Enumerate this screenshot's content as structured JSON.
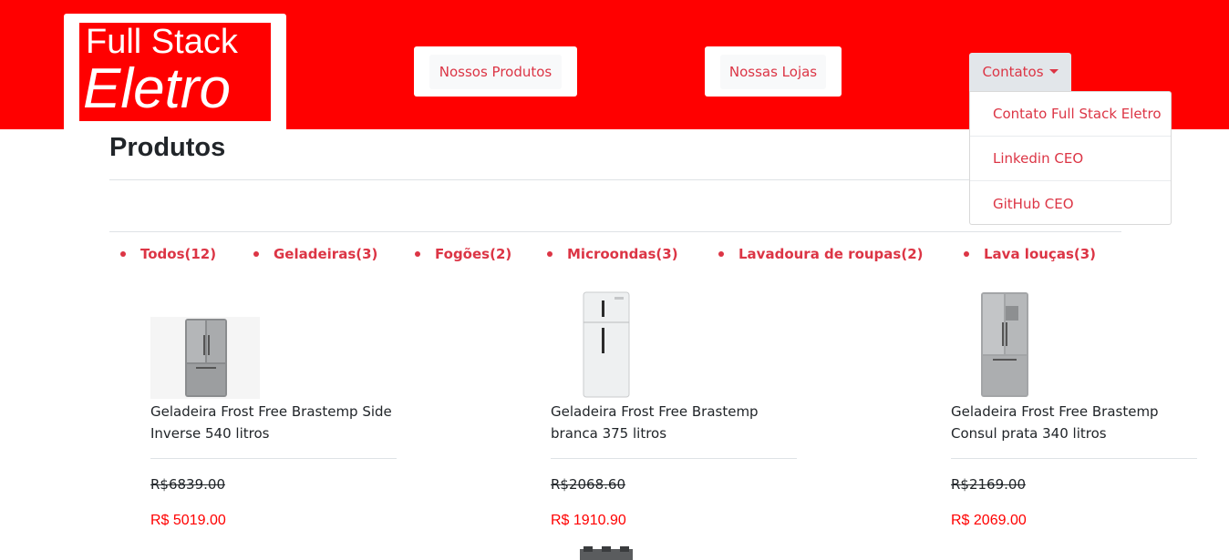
{
  "header": {
    "logo_line1": "Full Stack",
    "logo_line2": "Eletro",
    "nav": {
      "produtos": "Nossos Produtos",
      "lojas": "Nossas Lojas",
      "contatos": "Contatos"
    },
    "dropdown": [
      "Contato Full Stack Eletro",
      "Linkedin CEO",
      "GitHub CEO"
    ]
  },
  "main": {
    "title": "Produtos",
    "categories": [
      "Todos(12)",
      "Geladeiras(3)",
      "Fogões(2)",
      "Microondas(3)",
      "Lavadoura de roupas(2)",
      "Lava louças(3)"
    ],
    "products": [
      {
        "name": "Geladeira Frost Free Brastemp Side Inverse 540 litros",
        "old_price": "R$6839.00",
        "price": "R$ 5019.00",
        "image": "fridge-side-inverse-image"
      },
      {
        "name": "Geladeira Frost Free Brastemp branca 375 litros",
        "old_price": "R$2068.60",
        "price": "R$ 1910.90",
        "image": "fridge-white-image"
      },
      {
        "name": "Geladeira Frost Free Brastemp Consul prata 340 litros",
        "old_price": "R$2169.00",
        "price": "R$ 2069.00",
        "image": "fridge-silver-image"
      }
    ]
  },
  "colors": {
    "header_bg": "#ff0000",
    "accent": "#dc3545",
    "price": "#ff0000"
  }
}
